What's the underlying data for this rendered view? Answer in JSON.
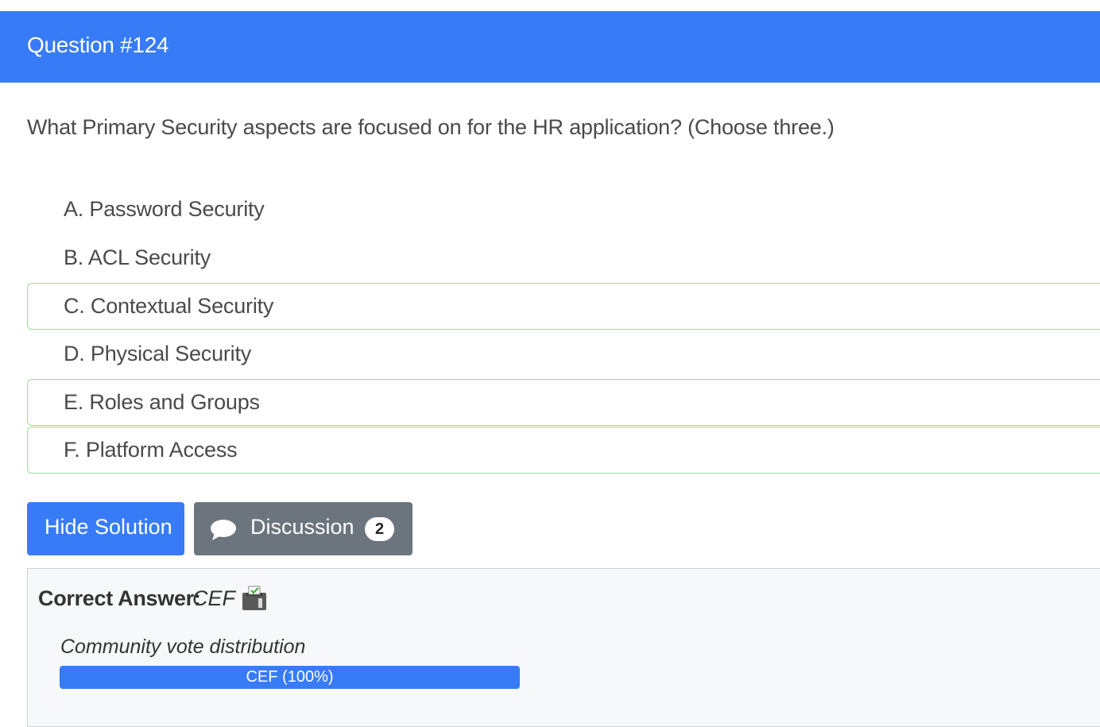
{
  "header": {
    "title": "Question #124"
  },
  "question": {
    "text": "What Primary Security aspects are focused on for the HR application? (Choose three.)"
  },
  "choices": [
    {
      "label": "A. Password Security",
      "correct": false
    },
    {
      "label": "B. ACL Security",
      "correct": false
    },
    {
      "label": "C. Contextual Security",
      "correct": true
    },
    {
      "label": "D. Physical Security",
      "correct": false
    },
    {
      "label": "E. Roles and Groups",
      "correct": true
    },
    {
      "label": "F. Platform Access",
      "correct": true
    }
  ],
  "buttons": {
    "hide_solution": "Hide Solution",
    "discussion": "Discussion",
    "discussion_count": "2",
    "discussion_icon": "comment-icon"
  },
  "answer": {
    "label": "Correct Answer:",
    "value": "CEF",
    "vote_icon": "ballot-box-icon",
    "distribution_label": "Community vote distribution",
    "distribution": [
      {
        "text": "CEF (100%)",
        "percent": 100
      }
    ]
  },
  "colors": {
    "accent": "#377bf6",
    "secondary": "#6c757d",
    "correct_border": "#9be29b"
  }
}
